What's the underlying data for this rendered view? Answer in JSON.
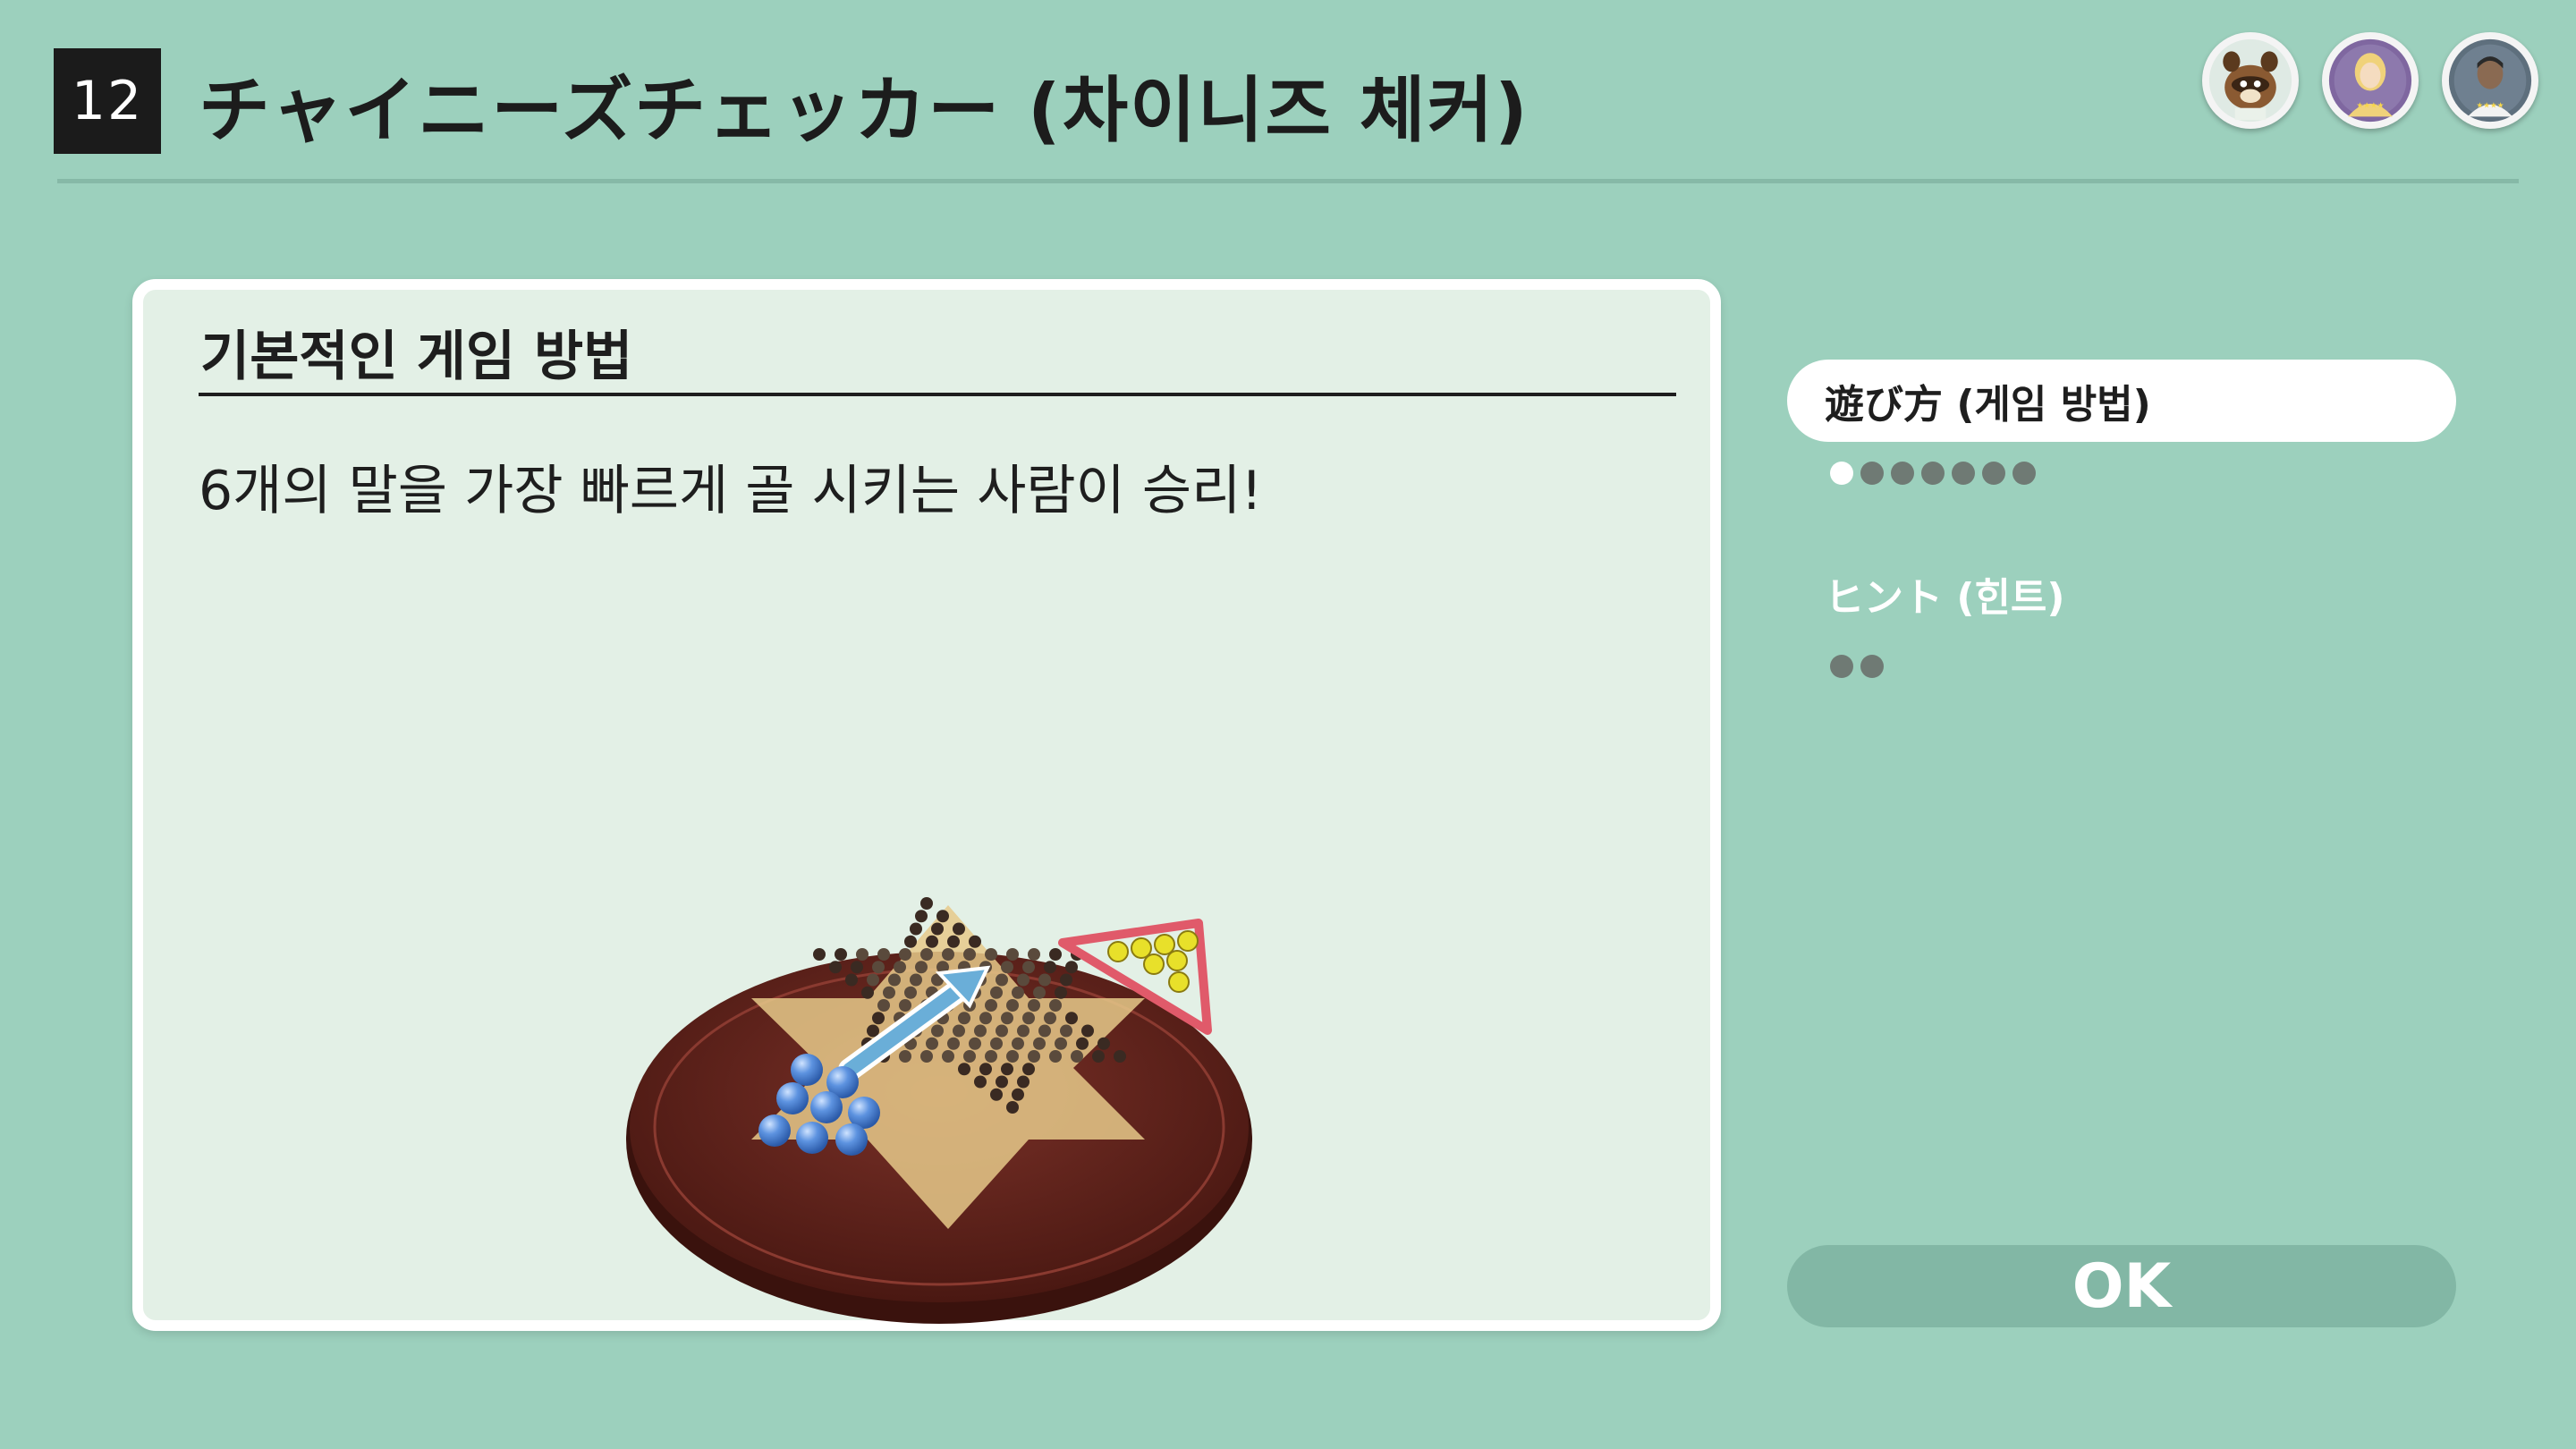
{
  "header": {
    "game_number": "12",
    "title": "チャイニーズチェッカー (차이니즈 체커)",
    "players": [
      {
        "name": "raccoon-player-avatar"
      },
      {
        "name": "blonde-player-avatar"
      },
      {
        "name": "dark-hair-player-avatar"
      }
    ]
  },
  "panel": {
    "heading": "기본적인 게임 방법",
    "body": "6개의 말을 가장 빠르게 골 시키는 사람이 승리!"
  },
  "sidebar": {
    "sections": [
      {
        "label": "遊び方 (게임 방법)",
        "selected": true,
        "page_count": 7,
        "current_page": 1
      },
      {
        "label": "ヒント (힌트)",
        "selected": false,
        "page_count": 2
      }
    ]
  },
  "ok_label": "OK",
  "colors": {
    "background": "#9cd0bd",
    "panel": "#e3f0e6",
    "board_wood": "#5a1f19",
    "arrow": "#6aaed8",
    "goal_triangle": "#e05a6a",
    "blue_piece": "#4f86d6",
    "yellow_piece": "#e8e02a"
  }
}
